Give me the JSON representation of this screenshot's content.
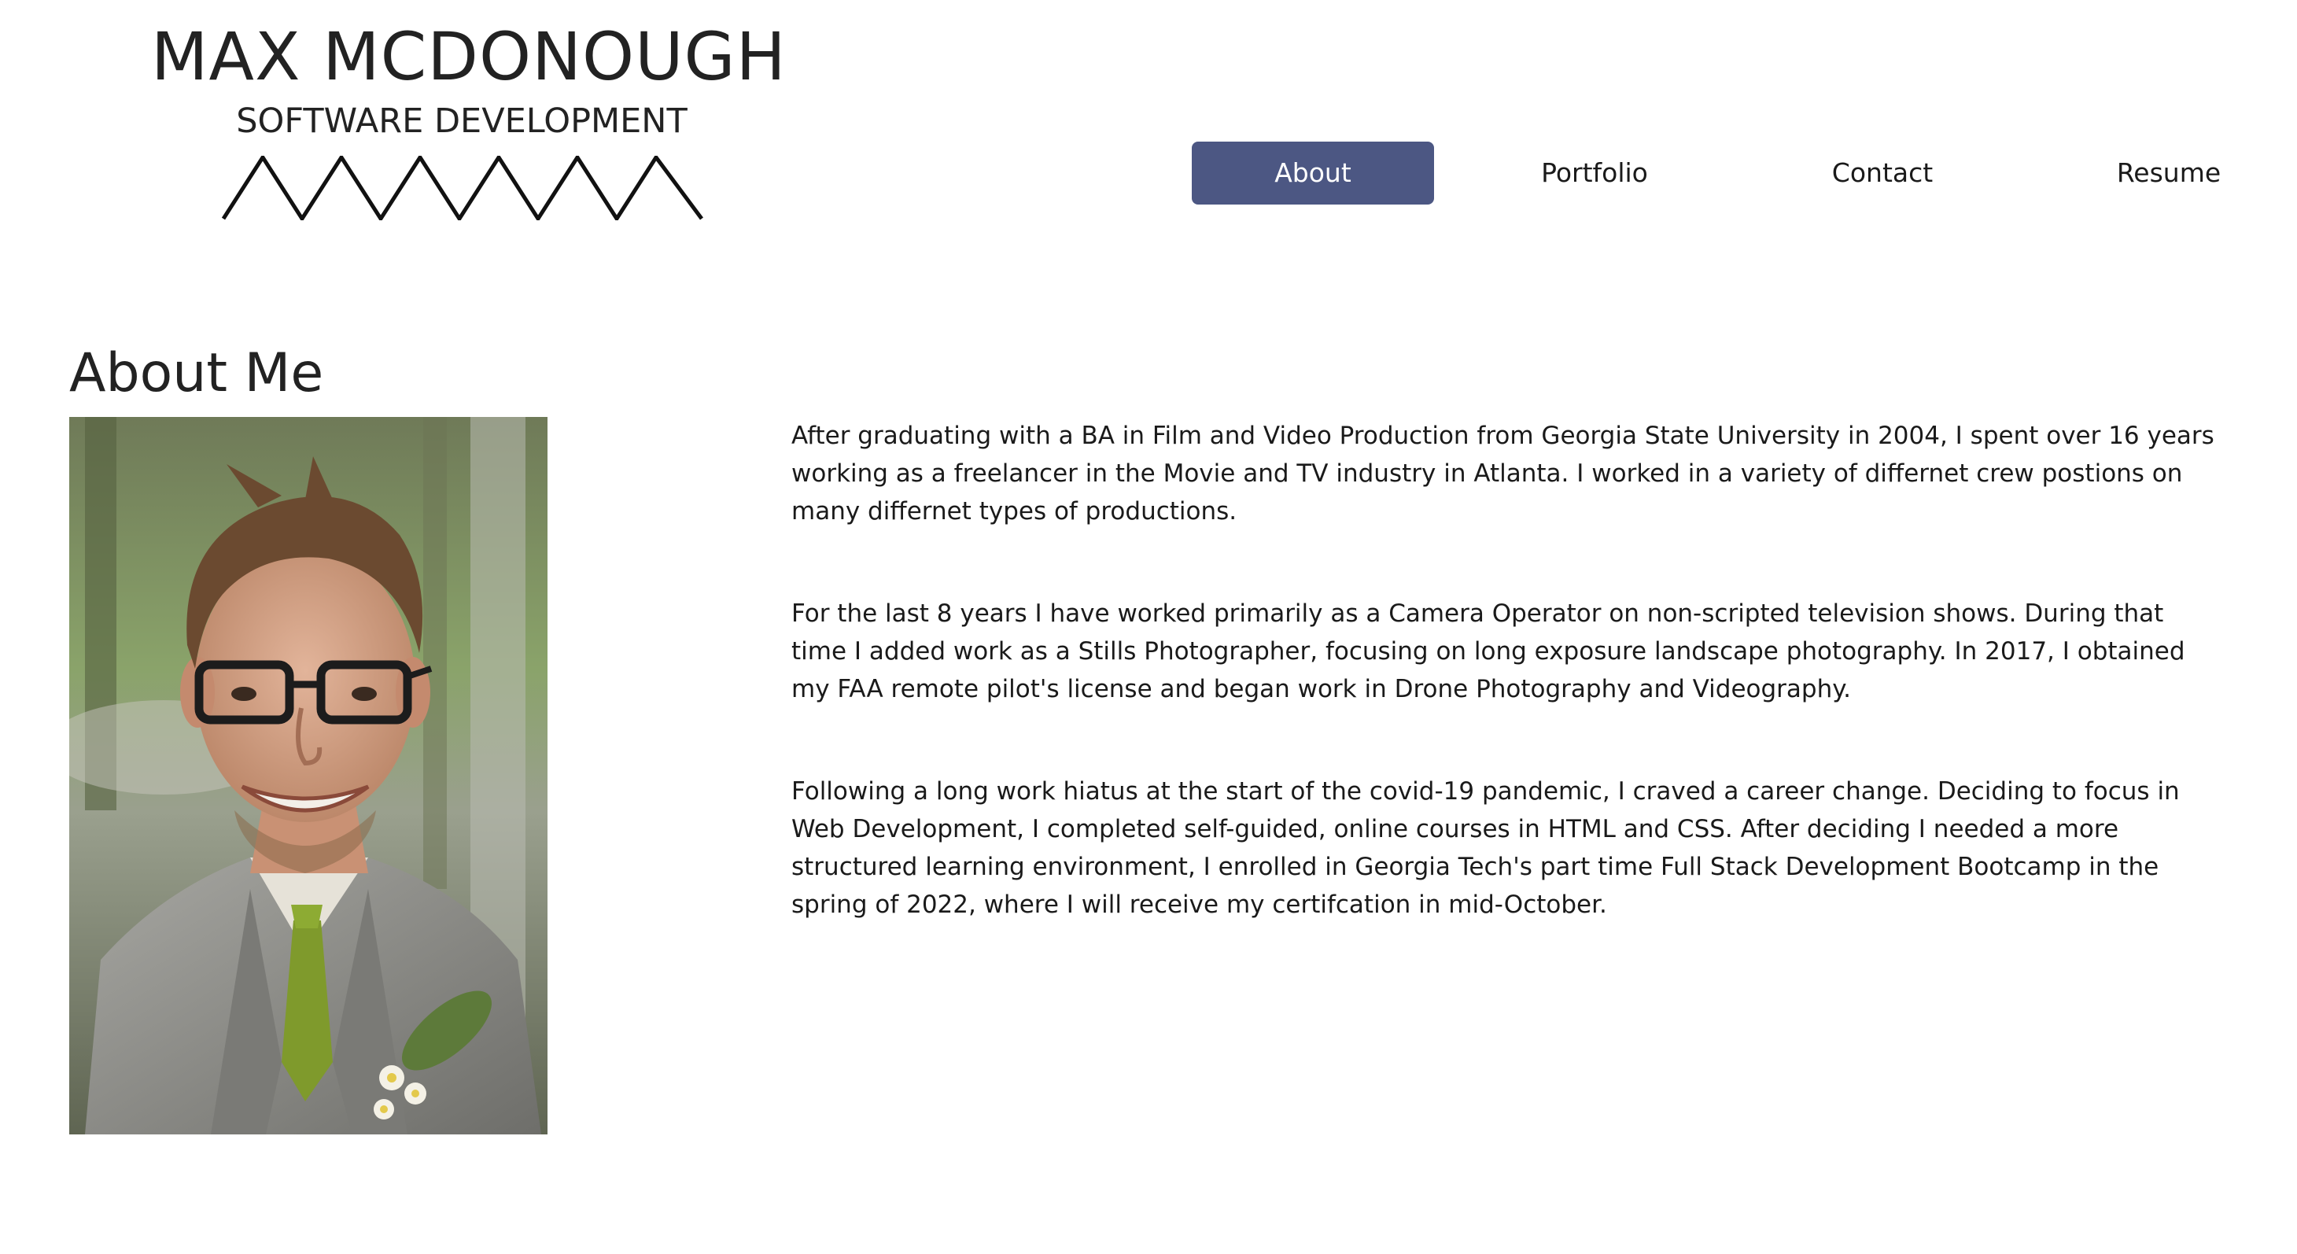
{
  "header": {
    "name": "MAX MCDONOUGH",
    "subtitle": "SOFTWARE DEVELOPMENT"
  },
  "nav": {
    "items": [
      {
        "label": "About",
        "active": true
      },
      {
        "label": "Portfolio",
        "active": false
      },
      {
        "label": "Contact",
        "active": false
      },
      {
        "label": "Resume",
        "active": false
      }
    ]
  },
  "about": {
    "title": "About Me",
    "paragraphs": [
      "After graduating with a BA in Film and Video Production from Georgia State University in 2004, I spent over 16 years working as a freelancer in the Movie and TV industry in Atlanta. I worked in a variety of differnet crew postions on many differnet types of productions.",
      "For the last 8 years I have worked primarily as a Camera Operator on non-scripted television shows. During that time I added work as a Stills Photographer, focusing on long exposure landscape photography. In 2017, I obtained my FAA remote pilot's license and began work in Drone Photography and Videography.",
      "Following a long work hiatus at the start of the covid-19 pandemic, I craved a career change. Deciding to focus in Web Development, I completed self-guided, online courses in HTML and CSS. After deciding I needed a more structured learning environment, I enrolled in Georgia Tech's part time Full Stack Development Bootcamp in the spring of 2022, where I will receive my certifcation in mid-October."
    ]
  },
  "colors": {
    "nav_active_bg": "#4c5783",
    "text": "#1a1a1a",
    "background": "#ffffff"
  }
}
